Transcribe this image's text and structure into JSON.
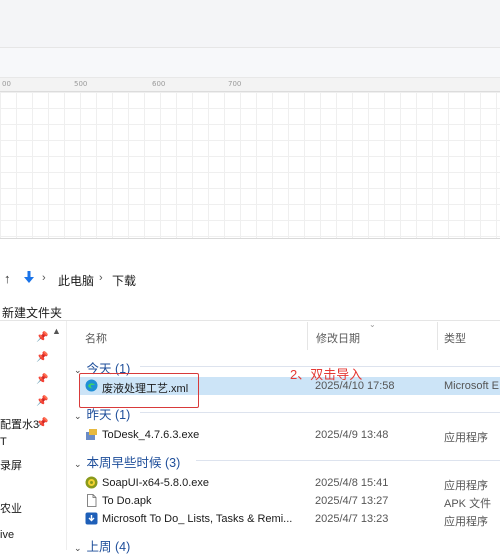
{
  "ruler": {
    "marks": [
      "00",
      "500",
      "600",
      "700",
      "800"
    ]
  },
  "address": {
    "path": [
      "此电脑",
      "下载"
    ]
  },
  "toolbar": {
    "new_folder": "新建文件夹"
  },
  "nav": {
    "items": [
      "配置水3",
      "T",
      "录屏",
      "农业",
      "ive"
    ]
  },
  "columns": {
    "name": "名称",
    "date": "修改日期",
    "type": "类型"
  },
  "groups": [
    {
      "label": "今天 (1)"
    },
    {
      "label": "昨天 (1)"
    },
    {
      "label": "本周早些时候 (3)"
    },
    {
      "label": "上周 (4)"
    }
  ],
  "files": [
    {
      "name": "废液处理工艺.xml",
      "date": "2025/4/10 17:58",
      "type": "Microsoft E",
      "icon": "edge-icon",
      "selected": true
    },
    {
      "name": "ToDesk_4.7.6.3.exe",
      "date": "2025/4/9 13:48",
      "type": "应用程序",
      "icon": "installer-icon"
    },
    {
      "name": "SoapUI-x64-5.8.0.exe",
      "date": "2025/4/8 15:41",
      "type": "应用程序",
      "icon": "soapui-icon"
    },
    {
      "name": "To Do.apk",
      "date": "2025/4/7 13:27",
      "type": "APK 文件",
      "icon": "file-icon"
    },
    {
      "name": "Microsoft To Do_ Lists, Tasks & Remi...",
      "date": "2025/4/7 13:23",
      "type": "应用程序",
      "icon": "download-app-icon"
    }
  ],
  "annotation": {
    "text": "2、双击导入"
  },
  "colors": {
    "accent": "#1e4e9a",
    "selection": "#cce4f7",
    "annotation": "#d83a3a"
  }
}
